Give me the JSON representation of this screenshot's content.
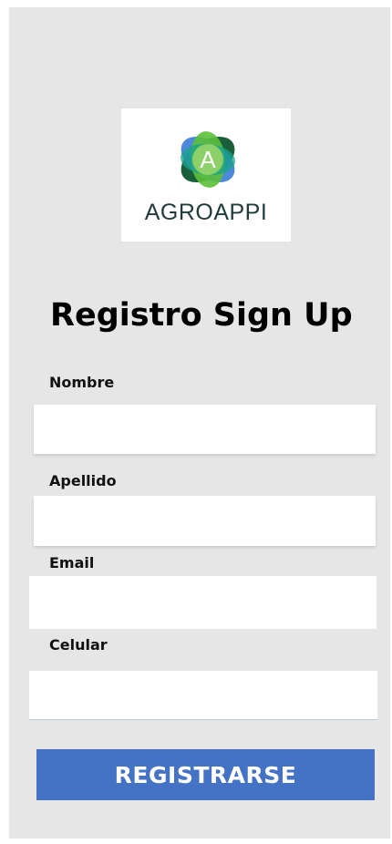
{
  "logo": {
    "text": "AGROAPPI",
    "emblem_letter": "A",
    "icon": "agroappi-logo-icon",
    "colors": {
      "green": "#5cbf3a",
      "teal": "#1aa38a",
      "blue": "#3a7bd5",
      "dark": "#1b5e3a",
      "text": "#1f3b3a"
    }
  },
  "form": {
    "title": "Registro Sign Up",
    "fields": [
      {
        "label": "Nombre",
        "value": "",
        "placeholder": ""
      },
      {
        "label": "Apellido",
        "value": "",
        "placeholder": ""
      },
      {
        "label": "Email",
        "value": "",
        "placeholder": ""
      },
      {
        "label": "Celular",
        "value": "",
        "placeholder": ""
      }
    ],
    "submit_label": "REGISTRARSE"
  },
  "colors": {
    "background": "#e6e6e6",
    "field": "#ffffff",
    "button": "#4472c4",
    "button_text": "#ffffff"
  }
}
